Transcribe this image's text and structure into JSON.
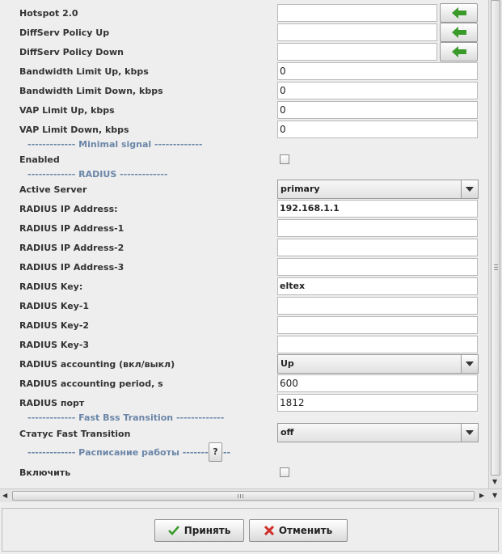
{
  "form": {
    "hotspot": {
      "label": "Hotspot 2.0",
      "value": ""
    },
    "diffserv_up": {
      "label": "DiffServ Policy Up",
      "value": ""
    },
    "diffserv_down": {
      "label": "DiffServ Policy Down",
      "value": ""
    },
    "bw_up": {
      "label": "Bandwidth Limit Up, kbps",
      "value": "0"
    },
    "bw_down": {
      "label": "Bandwidth Limit Down, kbps",
      "value": "0"
    },
    "vap_up": {
      "label": "VAP Limit Up, kbps",
      "value": "0"
    },
    "vap_down": {
      "label": "VAP Limit Down, kbps",
      "value": "0"
    },
    "sep_minimal": "------------- Minimal signal -------------",
    "enabled": {
      "label": "Enabled",
      "checked": false
    },
    "sep_radius": "------------- RADIUS -------------",
    "active_server": {
      "label": "Active Server",
      "value": "primary"
    },
    "radius_ip": {
      "label": "RADIUS IP Address:",
      "value": "192.168.1.1"
    },
    "radius_ip1": {
      "label": "RADIUS IP Address-1",
      "value": ""
    },
    "radius_ip2": {
      "label": "RADIUS IP Address-2",
      "value": ""
    },
    "radius_ip3": {
      "label": "RADIUS IP Address-3",
      "value": ""
    },
    "radius_key": {
      "label": "RADIUS Key:",
      "value": "eltex"
    },
    "radius_key1": {
      "label": "RADIUS Key-1",
      "value": ""
    },
    "radius_key2": {
      "label": "RADIUS Key-2",
      "value": ""
    },
    "radius_key3": {
      "label": "RADIUS Key-3",
      "value": ""
    },
    "radius_acct": {
      "label": "RADIUS accounting (вкл/выкл)",
      "value": "Up"
    },
    "radius_acct_period": {
      "label": "RADIUS accounting period, s",
      "value": "600"
    },
    "radius_port": {
      "label": "RADIUS порт",
      "value": "1812"
    },
    "sep_fbt": "------------- Fast Bss Transition -------------",
    "fast_transition": {
      "label": "Статус Fast Transition",
      "value": "off"
    },
    "sep_schedule": "------------- Расписание работы -------------",
    "help_button": "?",
    "enable_schedule": {
      "label": "Включить",
      "checked": false
    }
  },
  "buttons": {
    "apply": "Принять",
    "cancel": "Отменить"
  },
  "colors": {
    "arrow_green": "#3a9a2a",
    "cancel_red": "#d0302a",
    "separator": "#6b86a8"
  }
}
